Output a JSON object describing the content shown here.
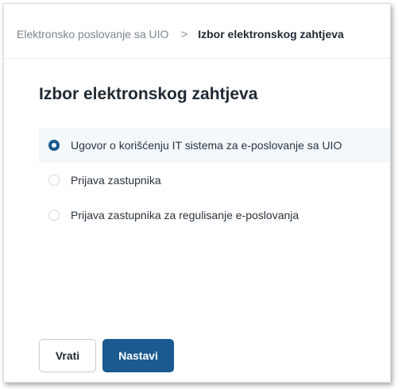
{
  "breadcrumb": {
    "parent": "Elektronsko poslovanje sa UIO",
    "separator": ">",
    "current": "Izbor elektronskog zahtjeva"
  },
  "page_title": "Izbor elektronskog zahtjeva",
  "options": [
    {
      "label": "Ugovor o korišćenju IT sistema za e-poslovanje sa UIO",
      "selected": true
    },
    {
      "label": "Prijava zastupnika",
      "selected": false
    },
    {
      "label": "Prijava zastupnika za regulisanje e-poslovanja",
      "selected": false
    }
  ],
  "actions": {
    "back_label": "Vrati",
    "next_label": "Nastavi"
  },
  "colors": {
    "primary": "#1a5a91",
    "selected_row_background": "#f3f8fc"
  }
}
